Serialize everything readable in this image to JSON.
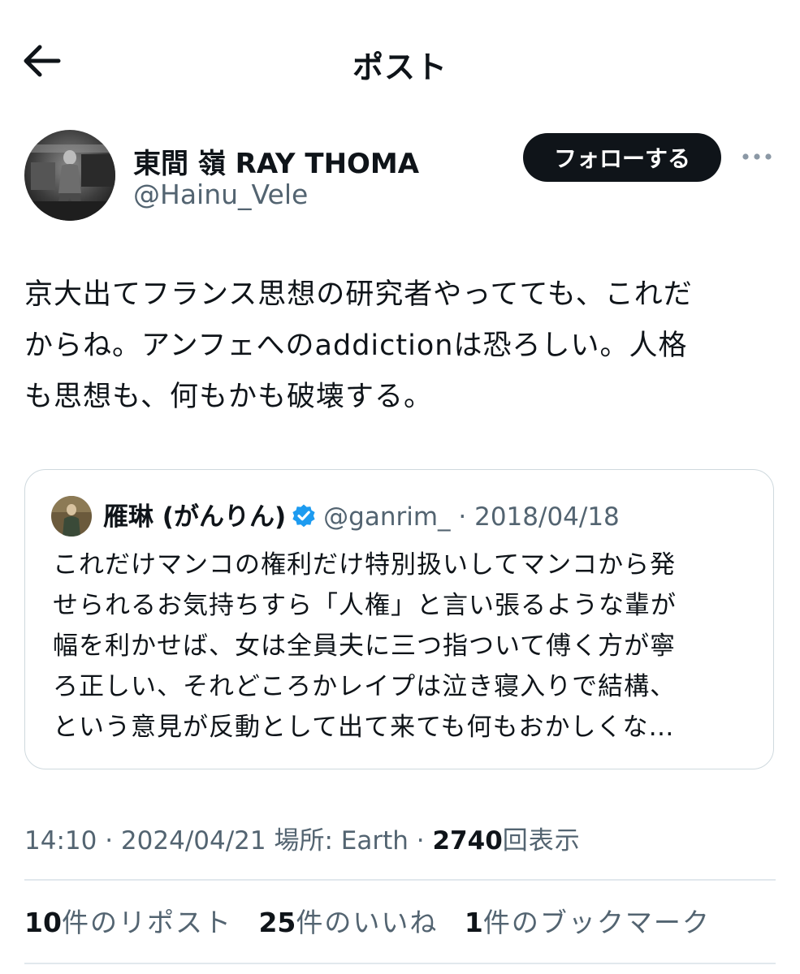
{
  "header": {
    "title": "ポスト",
    "back_icon": "arrow-left-icon"
  },
  "author": {
    "name": "東間 嶺 RAY THOMA",
    "handle": "@Hainu_Vele",
    "follow_label": "フォローする",
    "more_icon": "more-horizontal-icon"
  },
  "post": {
    "lines": [
      "京大出てフランス思想の研究者やってても、これだ",
      "からね。アンフェへのaddictionは恐ろしい。人格",
      "も思想も、何もかも破壊する。"
    ]
  },
  "quote": {
    "name": "雁琳 (がんりん)",
    "verified_icon": "verified-badge-icon",
    "handle": "@ganrim_",
    "separator": "·",
    "date": "2018/04/18",
    "lines": [
      "これだけマンコの権利だけ特別扱いしてマンコから発",
      "せられるお気持ちすら「人権」と言い張るような輩が",
      "幅を利かせば、女は全員夫に三つ指ついて傅く方が寧",
      "ろ正しい、それどころかレイプは泣き寝入りで結構、",
      "という意見が反動として出て来ても何もおかしくな…"
    ]
  },
  "meta": {
    "time": "14:10",
    "sep1": "·",
    "date": "2024/04/21",
    "location": "場所: Earth",
    "sep2": "·",
    "views_count": "2740",
    "views_label": "回表示"
  },
  "stats": {
    "reposts_count": "10",
    "reposts_label": "件のリポスト",
    "likes_count": "25",
    "likes_label": "件のいいね",
    "bookmarks_count": "1",
    "bookmarks_label": "件のブックマーク"
  },
  "colors": {
    "text": "#0f1419",
    "secondary": "#536471",
    "follow_bg": "#0f1419",
    "verified": "#1d9bf0",
    "border": "#cfd9de"
  }
}
